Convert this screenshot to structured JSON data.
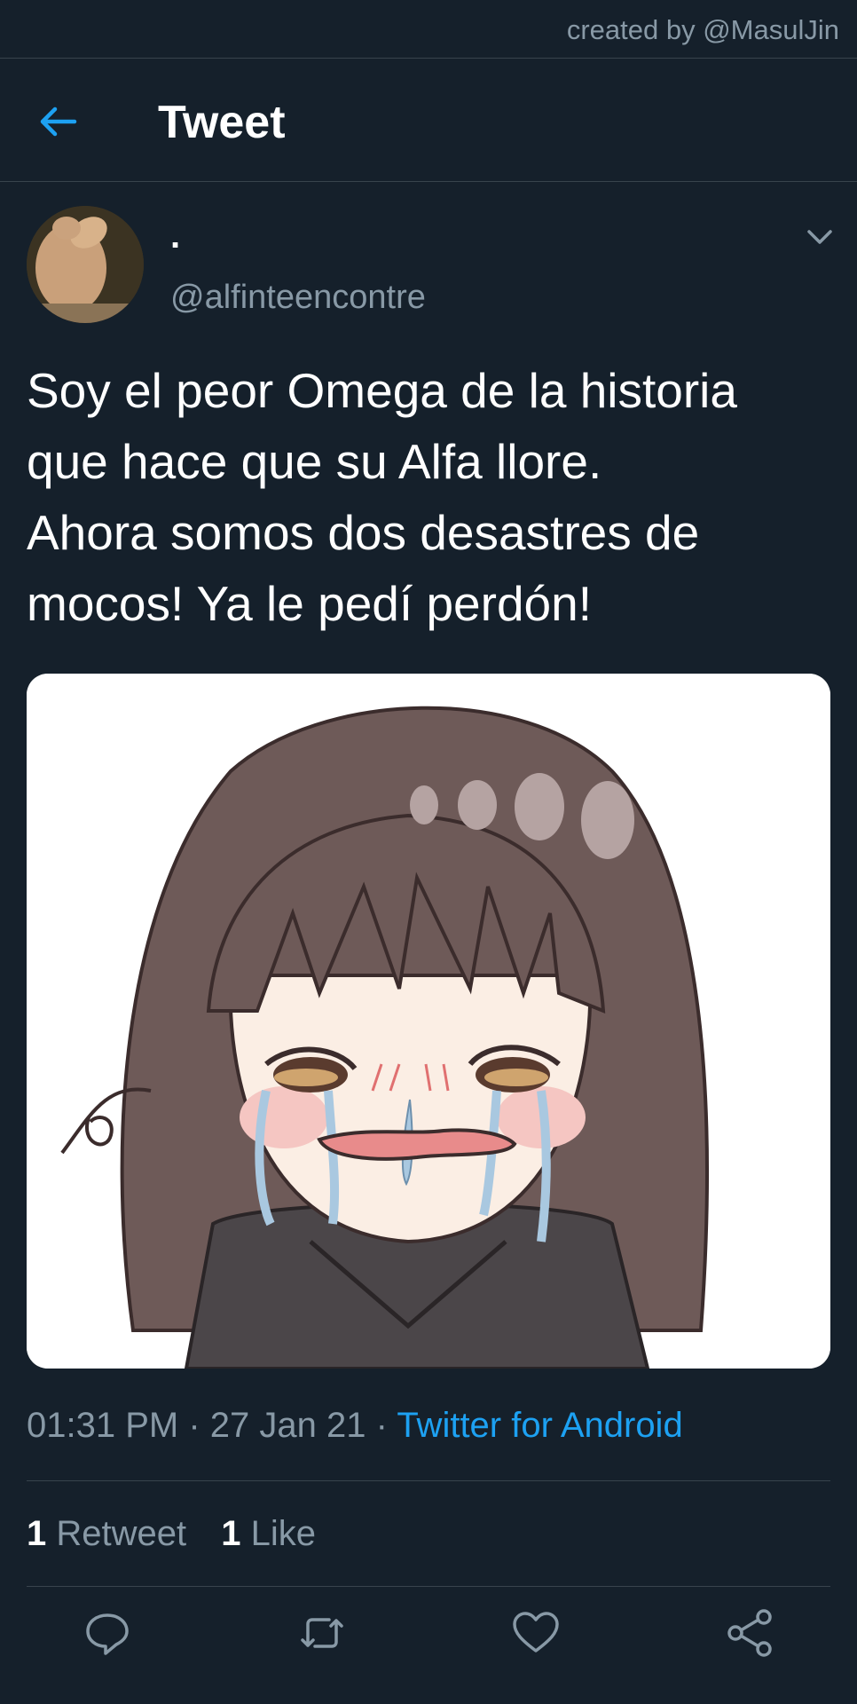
{
  "credit": "created by @MasulJin",
  "header": {
    "title": "Tweet",
    "back_icon": "arrow-left-icon"
  },
  "tweet": {
    "display_name": ".",
    "handle": "@alfinteencontre",
    "text_lines": [
      "Soy el peor Omega de la historia",
      "que hace que su Alfa llore.",
      "Ahora somos dos desastres de",
      "mocos! Ya le pedí perdón!"
    ],
    "time": "01:31 PM",
    "date": "27 Jan 21",
    "source": "Twitter for Android",
    "retweets_count": "1",
    "retweets_label": "Retweet",
    "likes_count": "1",
    "likes_label": "Like"
  },
  "colors": {
    "background": "#15202b",
    "accent": "#1da1f2",
    "muted": "#8899a6",
    "divider": "#38444d"
  },
  "icons": [
    "arrow-left-icon",
    "chevron-down-icon",
    "reply-icon",
    "retweet-icon",
    "like-icon",
    "share-icon"
  ]
}
